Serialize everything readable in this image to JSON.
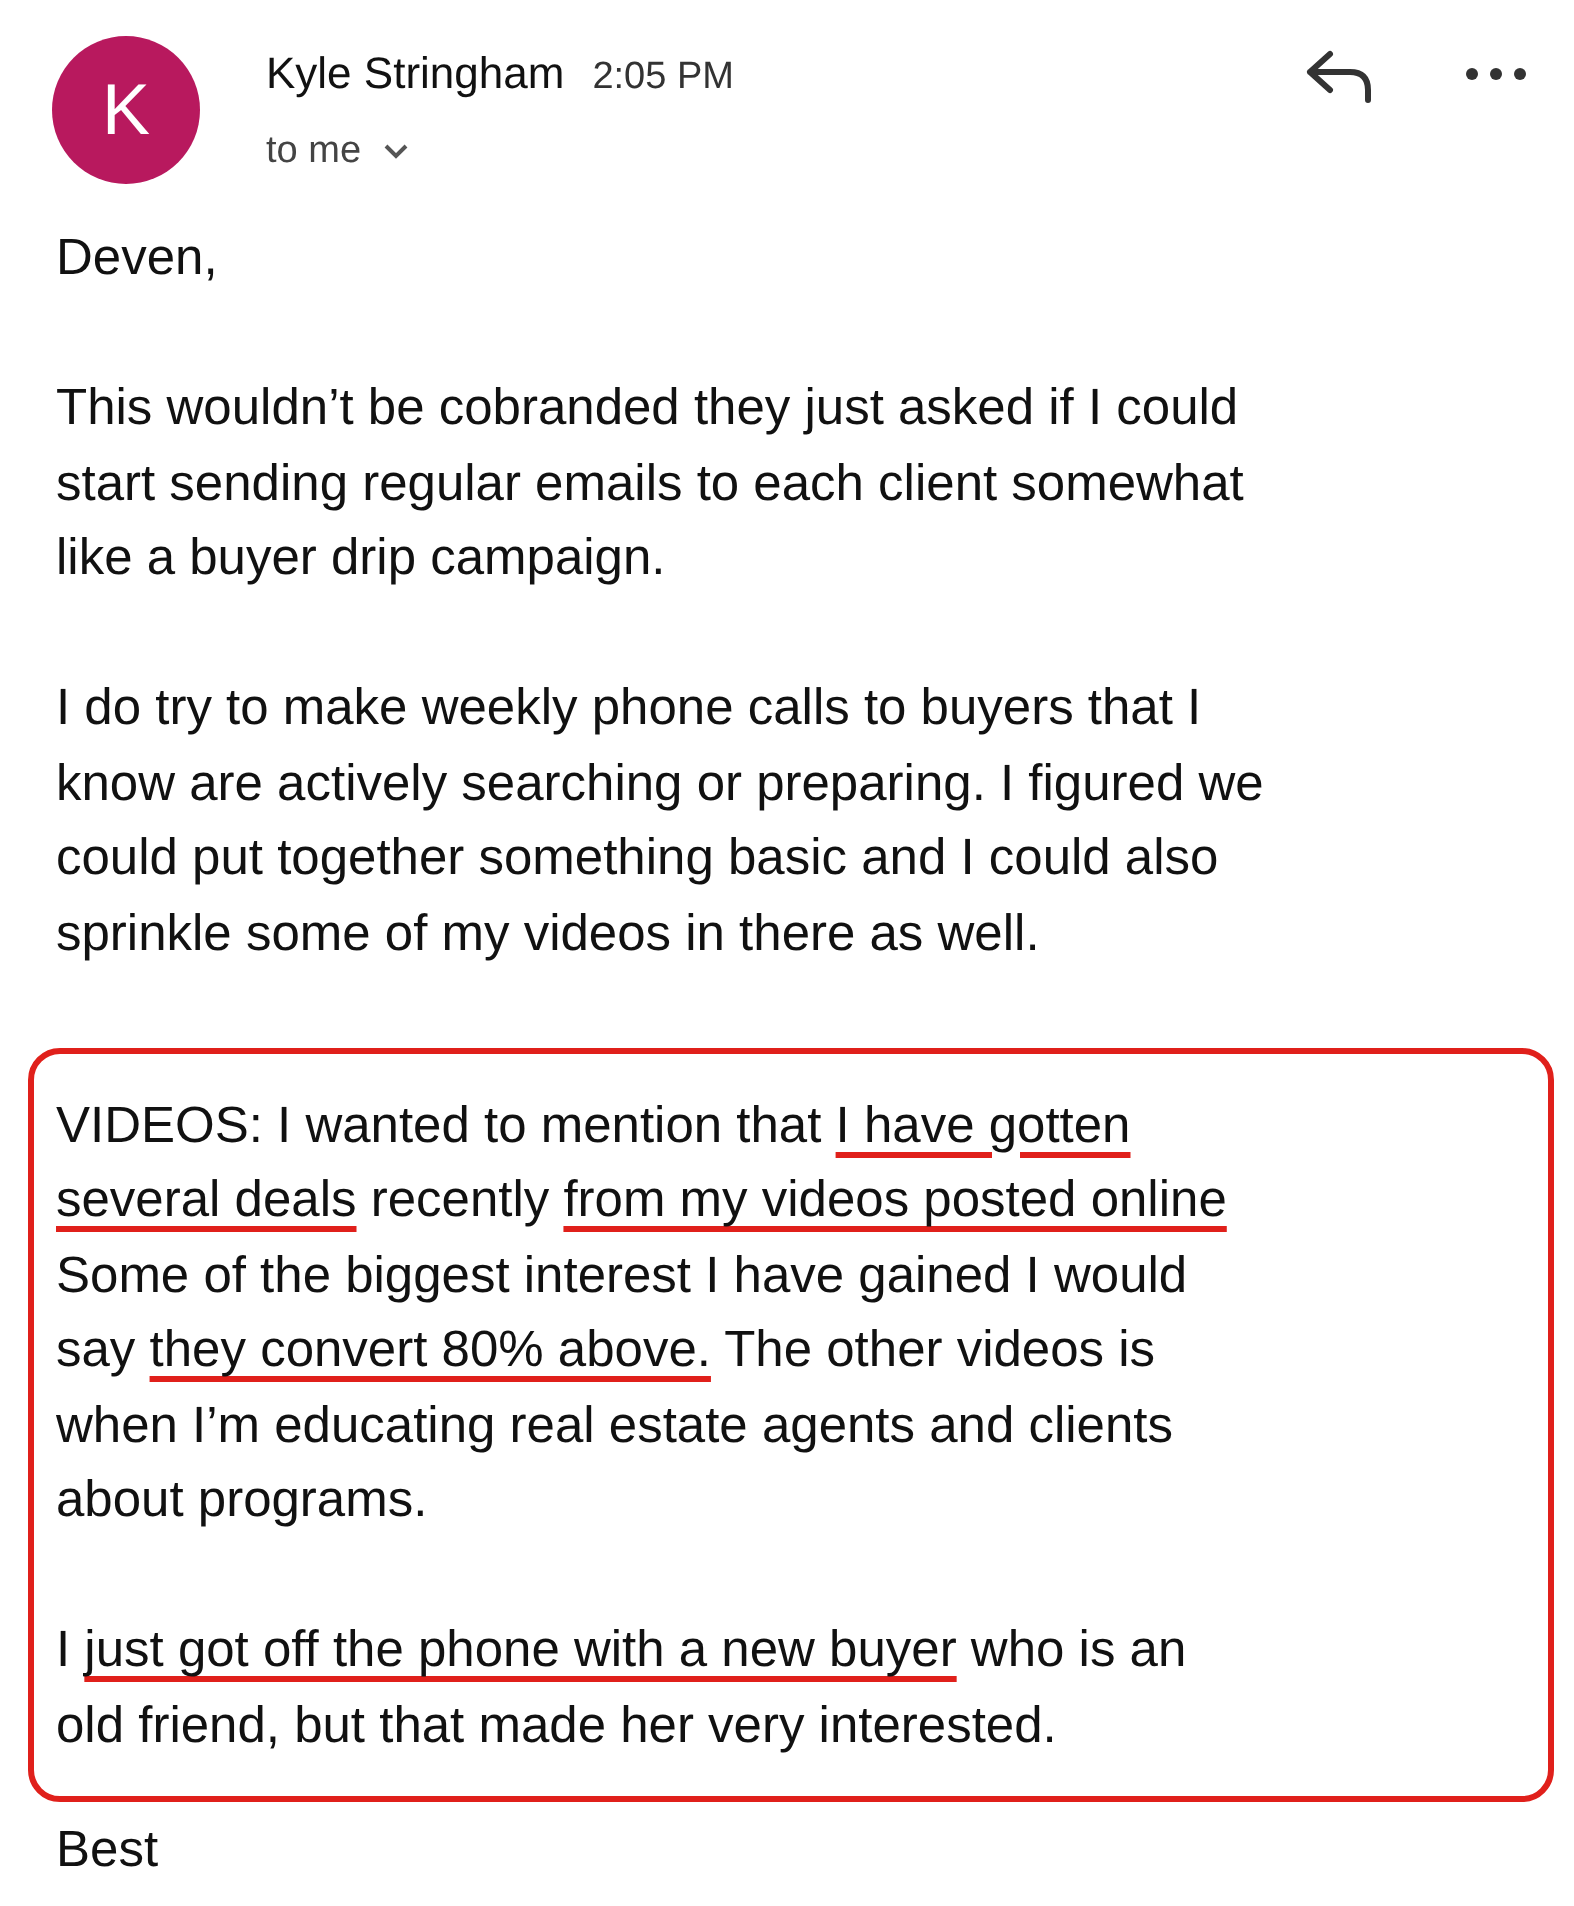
{
  "header": {
    "avatar_letter": "K",
    "sender": "Kyle Stringham",
    "time": "2:05 PM",
    "recipient": "to me"
  },
  "body": {
    "greeting": "Deven,",
    "paragraphs": [
      [
        "This wouldn’t be cobranded they just asked if I could",
        "start sending regular emails to each client somewhat",
        "like a buyer drip campaign."
      ],
      [
        "I do try to make weekly phone calls to buyers that I",
        "know are actively searching or preparing. I figured we",
        "could put together something basic and I could also",
        "sprinkle some of my videos in there as well."
      ]
    ],
    "annotation_box": {
      "paragraphs": [
        [
          [
            {
              "kind": "plain",
              "text": "VIDEOS: I wanted to mention that "
            },
            {
              "kind": "underlined",
              "text": "I have gotten"
            }
          ],
          [
            {
              "kind": "underlined",
              "text": "several deals"
            },
            {
              "kind": "plain",
              "text": " recently "
            },
            {
              "kind": "underlined",
              "text": "from my videos posted online"
            }
          ],
          [
            {
              "kind": "plain",
              "text": "Some of the biggest interest I have gained I would"
            }
          ],
          [
            {
              "kind": "plain",
              "text": "say "
            },
            {
              "kind": "underlined",
              "text": "they convert 80% above."
            },
            {
              "kind": "plain",
              "text": " The other videos is"
            }
          ],
          [
            {
              "kind": "plain",
              "text": "when I’m educating real estate agents and clients"
            }
          ],
          [
            {
              "kind": "plain",
              "text": "about programs."
            }
          ]
        ],
        [
          [
            {
              "kind": "plain",
              "text": "I "
            },
            {
              "kind": "underlined",
              "text": "just got off the phone with a new buyer"
            },
            {
              "kind": "plain",
              "text": " who is an"
            }
          ],
          [
            {
              "kind": "plain",
              "text": "old friend, but that made her very interested."
            }
          ]
        ]
      ]
    },
    "closing": "Best"
  }
}
